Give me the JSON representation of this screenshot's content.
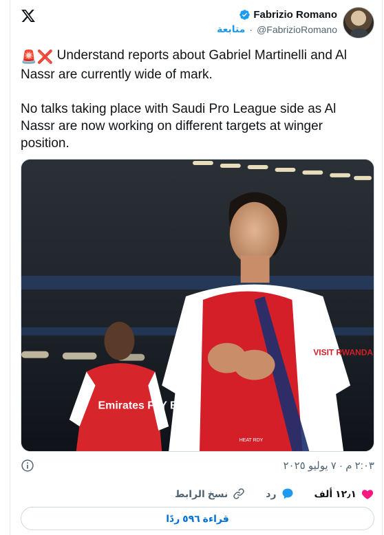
{
  "header": {
    "logo_icon": "x-logo-icon",
    "display_name": "Fabrizio Romano",
    "handle": "@FabrizioRomano",
    "follow_label": "متابعة",
    "separator": "·",
    "verified_icon": "verified-badge-icon",
    "verified_color": "#1d9bf0"
  },
  "tweet": {
    "emoji_1": "🚨",
    "emoji_2": "❌",
    "text_line1": " Understand reports about Gabriel Martinelli and Al Nassr are currently wide of mark.",
    "text_line2": "No talks taking place with Saudi Pro League side as Al Nassr are now working on different targets at winger position."
  },
  "media": {
    "shirt_sponsor_main": "VISIT RWANDA",
    "shirt_sponsor_left": "Emirates FLY BETTER",
    "shirt_tag": "HEAT RDY"
  },
  "meta": {
    "info_icon": "info-icon",
    "timestamp": "٢:٠٣ م · ٧ يوليو ٢٠٢٥"
  },
  "actions": {
    "like_count": "١٢٫١ ألف",
    "like_icon": "heart-icon",
    "like_color": "#f91880",
    "reply_label": "رد",
    "reply_icon": "reply-bubble-icon",
    "copy_link_label": "نسخ الرابط",
    "copy_link_icon": "link-icon"
  },
  "read_replies_label": "قراءة ٥٩٦ ردًا",
  "colors": {
    "accent": "#1d9bf0",
    "link": "#006fd6",
    "muted": "#536471",
    "text": "#0f1419"
  }
}
